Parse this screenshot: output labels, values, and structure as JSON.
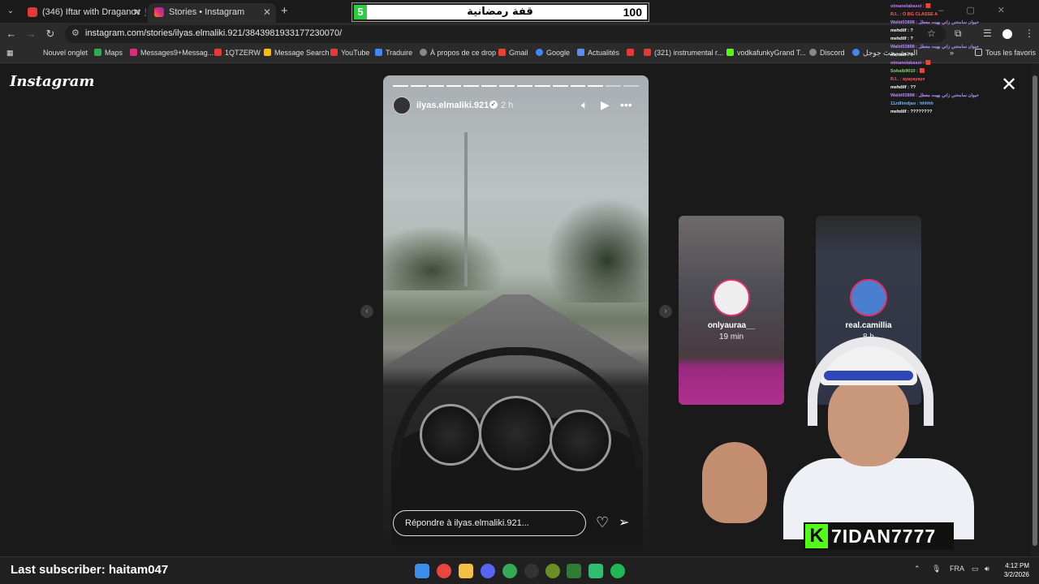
{
  "browser": {
    "tabs": [
      {
        "title": "(346) Iftar with Draganov 🧕 ...",
        "active": false
      },
      {
        "title": "Stories • Instagram",
        "active": true
      }
    ],
    "url": "instagram.com/stories/ilyas.elmaliki.921/3843981933177230070/",
    "bookmarks": [
      "Nouvel onglet",
      "Maps",
      "Messages9+Messag...",
      "1QTZERW",
      "Message Search",
      "YouTube",
      "Traduire",
      "À propos de ce drop",
      "Gmail",
      "Google",
      "Actualités",
      "",
      "(321) instrumental r...",
      "vodkafunkyGrand T...",
      "Discord",
      "البحث بحث جوجل",
      "Tous les favoris"
    ]
  },
  "overlay_counter": {
    "current": "5",
    "title": "قفة رمضانية",
    "target": "100"
  },
  "instagram": {
    "logo": "Instagram",
    "story": {
      "username": "ilyas.elmaliki.921",
      "time": "2 h",
      "reply_placeholder": "Répondre à ilyas.elmaliki.921...",
      "segments_total": 14,
      "segments_viewed": 12
    },
    "side_stories": [
      {
        "username": "onlyauraa__",
        "time": "19 min"
      },
      {
        "username": "real.camillia",
        "time": "8 h"
      }
    ]
  },
  "chat": [
    "otmanelabassi : 🟥",
    "RJ.. : O BG CLASSE A",
    "Walid03898 : حيوان سامحني زاني بهيت معطل",
    "mehdilf : ?",
    "mehdilf : ?",
    "Walid03898 : حيوان سامحني زاني بهيت معطل",
    "mehdilf : ?",
    "otmanelabassi : 🟥",
    "Sohaib9010 : 🟥",
    "RJ.. : ayayayaye",
    "mehdilf : ??",
    "Walid03898 : حيوان سامحني زاني بهيت معطل",
    "11zdlimdjao : hhhhh",
    "mehdilf : ????????"
  ],
  "stream": {
    "last_subscriber": "Last subscriber: haitam047",
    "logo_text": "7IDAN7777",
    "kick_glyph": "K"
  },
  "taskbar": {
    "lang": "FRA",
    "time": "4:12 PM",
    "date": "3/2/2026"
  }
}
